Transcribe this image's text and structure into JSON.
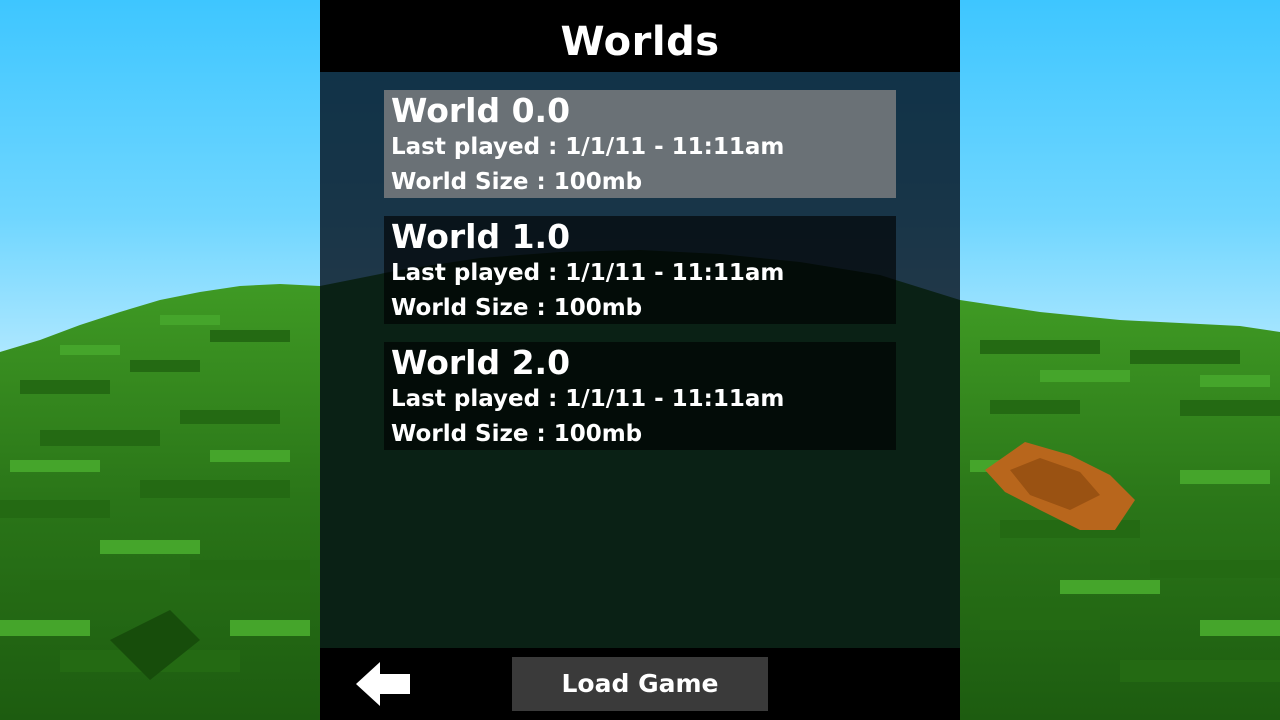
{
  "header": {
    "title": "Worlds"
  },
  "worlds": [
    {
      "name": "World 0.0",
      "last_played": "Last played : 1/1/11 - 11:11am",
      "size": "World Size : 100mb",
      "selected": true
    },
    {
      "name": "World 1.0",
      "last_played": "Last played : 1/1/11 - 11:11am",
      "size": "World Size : 100mb",
      "selected": false
    },
    {
      "name": "World 2.0",
      "last_played": "Last played : 1/1/11 - 11:11am",
      "size": "World Size : 100mb",
      "selected": false
    }
  ],
  "footer": {
    "back_icon": "arrow-left-icon",
    "load_label": "Load Game"
  },
  "colors": {
    "header_bg": "#000000",
    "selected_item_bg": "#767a7c",
    "item_bg": "#0b0b0b",
    "button_bg": "#3a3a3a",
    "text": "#ffffff",
    "sky": "#3ec6ff",
    "grass": "#2f7d1c",
    "dirt": "#b8661c"
  }
}
